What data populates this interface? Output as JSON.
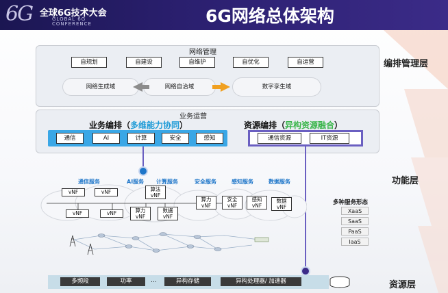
{
  "header": {
    "logo": "6G",
    "conference_cn": "全球6G技术大会",
    "conference_en": [
      "GLOBAL 6G",
      "CONFERENCE"
    ],
    "title": "6G网络总体架构"
  },
  "orchestration_layer": {
    "label": "编排管理层",
    "heading": "网络管理",
    "functions": [
      "自规划",
      "自建设",
      "自维护",
      "自优化",
      "自运营"
    ],
    "domains": [
      "网络生成域",
      "网络自治域",
      "数字孪生域"
    ]
  },
  "function_layer": {
    "label": "功能层",
    "business_ops_label": "业务运营",
    "service_orchestration": {
      "title": "业务编排（",
      "highlight": "多维能力协同",
      "close": "）",
      "items": [
        "通信",
        "AI",
        "计算",
        "安全",
        "感知"
      ]
    },
    "resource_orchestration": {
      "title": "资源编排（",
      "highlight": "异构资源融合",
      "close": "）",
      "items": [
        "通信资源",
        "IT资源"
      ]
    },
    "services": [
      "通信服务",
      "AI服务",
      "计算服务",
      "安全服务",
      "感知服务",
      "数据服务"
    ],
    "vnf_label": "vNF",
    "service_vnfs": [
      "算法\nvNF",
      "算力\nvNF",
      "数据\nvNF",
      "算力\nvNF",
      "安全\nvNF",
      "感知\nvNF",
      "数据\nvNF"
    ],
    "service_forms": {
      "title": "多种服务形态",
      "items": [
        "XaaS",
        "SaaS",
        "PaaS",
        "IaaS"
      ]
    }
  },
  "resource_layer": {
    "label": "资源层",
    "items": [
      "多频段",
      "功率",
      "…",
      "异构存储",
      "异构处理器/ 加速器"
    ]
  },
  "colors": {
    "header_bg": "#1b1652",
    "blue_accent": "#1e76c9",
    "green_highlight": "#39b54a",
    "resource_orch_border": "#6a5fc1",
    "service_orch_box": "#3aa7e6"
  }
}
